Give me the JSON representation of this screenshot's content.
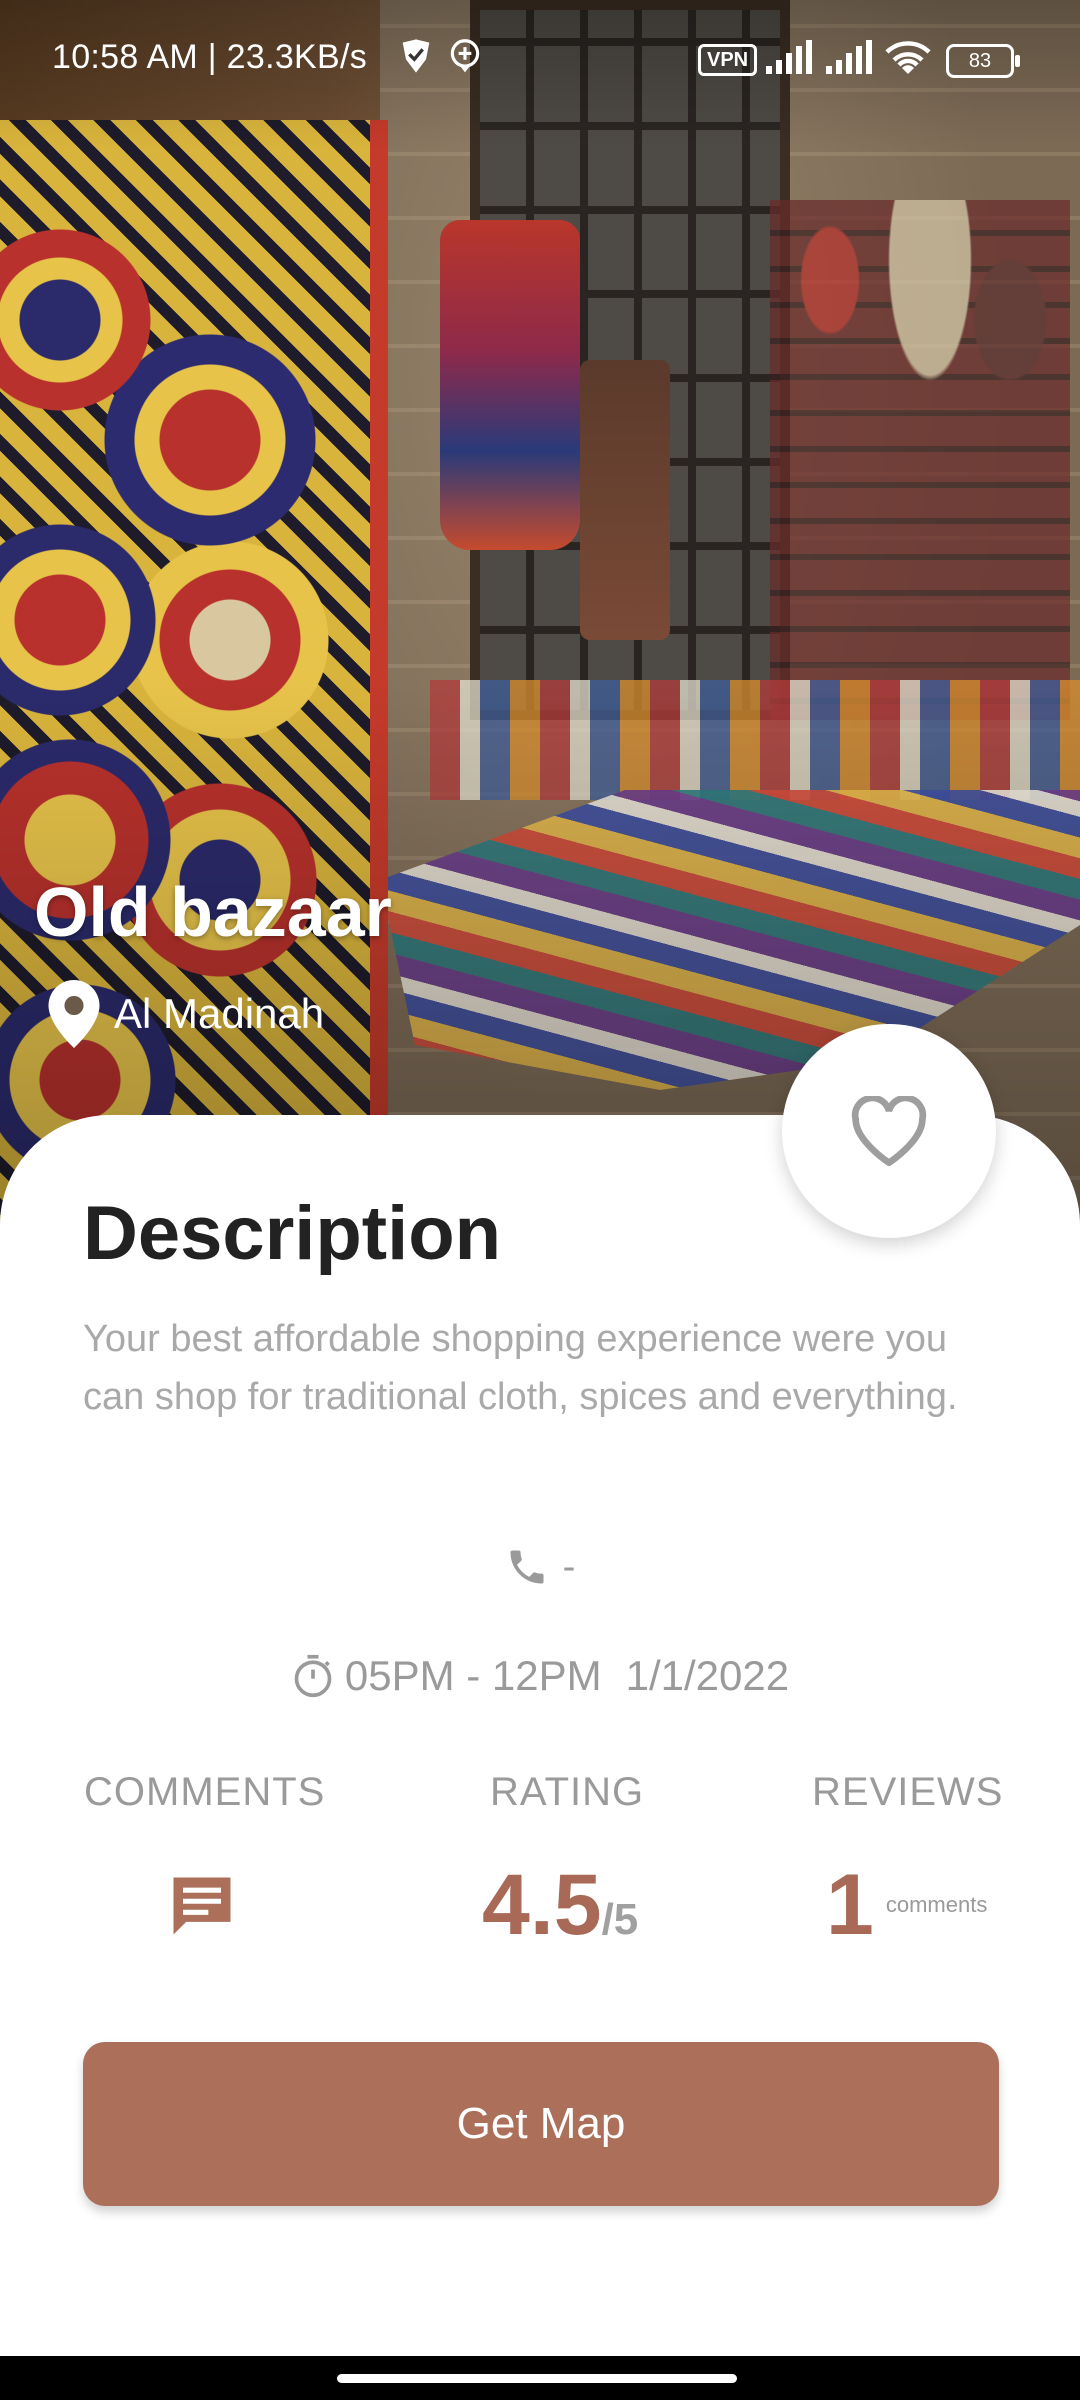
{
  "status_bar": {
    "time": "10:58 AM | 23.3KB/s",
    "vpn": "VPN",
    "battery": "83"
  },
  "place": {
    "title": "Old bazaar",
    "location": "Al Madinah"
  },
  "description": {
    "heading": "Description",
    "text": "Your best affordable shopping experience were you can shop for traditional cloth, spices and everything."
  },
  "phone": "-",
  "schedule": {
    "hours": "05PM - 12PM",
    "date": "1/1/2022"
  },
  "stats": {
    "comments_label": "COMMENTS",
    "rating_label": "RATING",
    "reviews_label": "REVIEWS",
    "rating_value": "4.5",
    "rating_max": "/5",
    "reviews_count": "1",
    "reviews_unit": "comments"
  },
  "actions": {
    "get_map": "Get Map"
  },
  "colors": {
    "accent": "#ab6f5a",
    "muted_text": "#9a9a9a"
  }
}
